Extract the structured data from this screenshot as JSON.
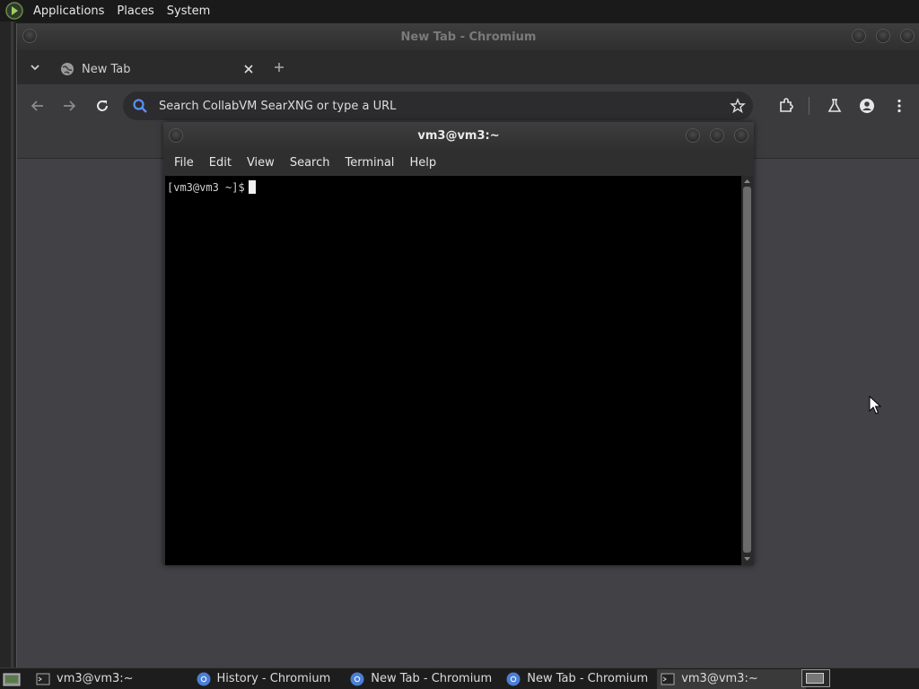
{
  "top_panel": {
    "menus": [
      "Applications",
      "Places",
      "System"
    ]
  },
  "chromium": {
    "window_title": "New Tab - Chromium",
    "tab_title": "New Tab",
    "omnibox_placeholder": "Search CollabVM SearXNG or type a URL"
  },
  "terminal": {
    "window_title": "vm3@vm3:~",
    "menus": [
      "File",
      "Edit",
      "View",
      "Search",
      "Terminal",
      "Help"
    ],
    "prompt": "[vm3@vm3 ~]$"
  },
  "taskbar": {
    "tasks": [
      {
        "label": "vm3@vm3:~",
        "icon": "terminal-icon"
      },
      {
        "label": "History - Chromium",
        "icon": "chromium-icon"
      },
      {
        "label": "New Tab - Chromium",
        "icon": "chromium-icon"
      },
      {
        "label": "New Tab - Chromium",
        "icon": "chromium-icon"
      },
      {
        "label": "vm3@vm3:~",
        "icon": "terminal-icon",
        "active": true
      }
    ]
  },
  "colors": {
    "accent_blue": "#5b8ff9",
    "terminal_bg": "#000000",
    "page_bg": "#414146"
  }
}
